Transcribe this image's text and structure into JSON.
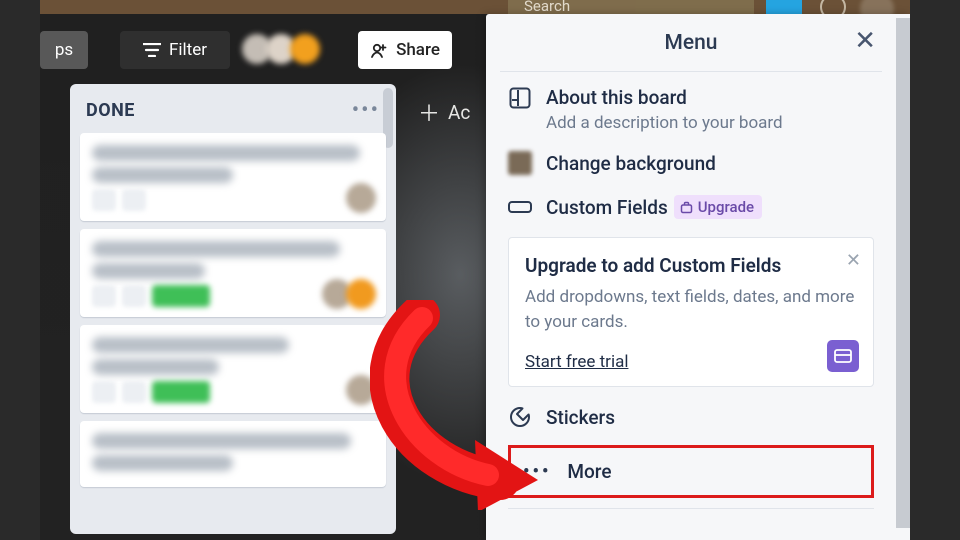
{
  "topbar": {
    "search_placeholder": "Search"
  },
  "toolbar": {
    "powerups_partial": "ps",
    "filter_label": "Filter",
    "share_label": "Share",
    "add_card_label": "Ac"
  },
  "list": {
    "title": "DONE"
  },
  "menu": {
    "title": "Menu",
    "about": {
      "label": "About this board",
      "sub": "Add a description to your board"
    },
    "background": {
      "label": "Change background"
    },
    "custom_fields": {
      "label": "Custom Fields",
      "badge": "Upgrade"
    },
    "promo": {
      "title": "Upgrade to add Custom Fields",
      "body": "Add dropdowns, text fields, dates, and more to your cards.",
      "cta": "Start free trial"
    },
    "stickers": {
      "label": "Stickers"
    },
    "more": {
      "label": "More"
    }
  }
}
